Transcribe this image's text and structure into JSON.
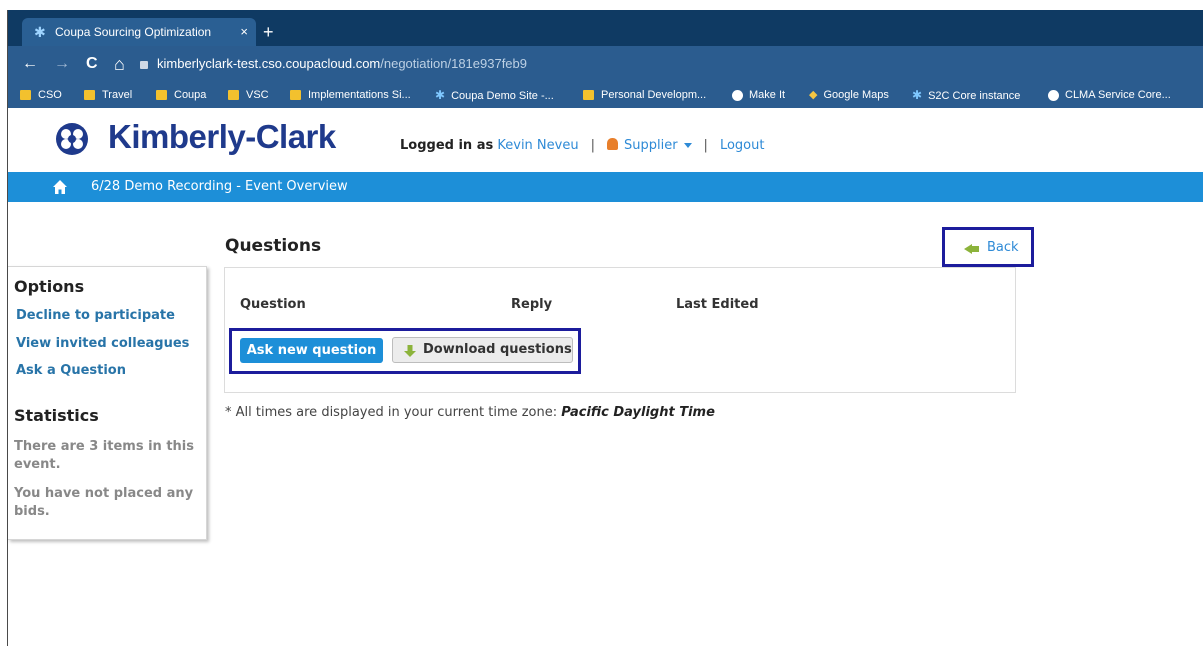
{
  "browser": {
    "tab_title": "Coupa Sourcing Optimization",
    "tab_close": "×",
    "new_tab": "+",
    "nav_back": "←",
    "nav_forward": "→",
    "nav_reload": "C",
    "nav_home": "⌂",
    "url_host": "kimberlyclark-test.cso.coupacloud.com",
    "url_path": "/negotiation/181e937feb9",
    "bookmarks": [
      {
        "label": "CSO",
        "icon": "folder"
      },
      {
        "label": "Travel",
        "icon": "folder"
      },
      {
        "label": "Coupa",
        "icon": "folder"
      },
      {
        "label": "VSC",
        "icon": "folder"
      },
      {
        "label": "Implementations Si...",
        "icon": "folder"
      },
      {
        "label": "Coupa Demo Site -...",
        "icon": "coupa-star"
      },
      {
        "label": "Personal Developm...",
        "icon": "folder"
      },
      {
        "label": "Make It",
        "icon": "globe"
      },
      {
        "label": "Google Maps",
        "icon": "maps-pin"
      },
      {
        "label": "S2C Core instance",
        "icon": "coupa-star"
      },
      {
        "label": "CLMA Service Core...",
        "icon": "globe"
      }
    ]
  },
  "header": {
    "logo_text": "Kimberly-Clark",
    "logged_in_label": "Logged in as",
    "user_name": "Kevin Neveu",
    "sep1": "|",
    "role_menu": "Supplier",
    "sep2": "|",
    "logout": "Logout"
  },
  "breadcrumb": {
    "text": "6/28 Demo Recording - Event Overview"
  },
  "sidebar": {
    "options_heading": "Options",
    "links": [
      "Decline to participate",
      "View invited colleagues",
      "Ask a Question"
    ],
    "statistics_heading": "Statistics",
    "stats": [
      "There are 3 items in this event.",
      "You have not placed any bids."
    ]
  },
  "main": {
    "title": "Questions",
    "back_label": "Back",
    "columns": [
      "Question",
      "Reply",
      "Last Edited"
    ],
    "ask_button": "Ask new question",
    "download_button": "Download questions",
    "timezone_prefix": "* All times are displayed in your current time zone:",
    "timezone_value": "Pacific Daylight Time"
  },
  "colors": {
    "tabbar": "#0f3a63",
    "toolbar": "#2b5c8f",
    "brand_blue": "#1f3a8c",
    "breadcrumb_bar": "#1d8fd8",
    "link": "#2874a8",
    "highlight_box": "#1c1c9c"
  }
}
